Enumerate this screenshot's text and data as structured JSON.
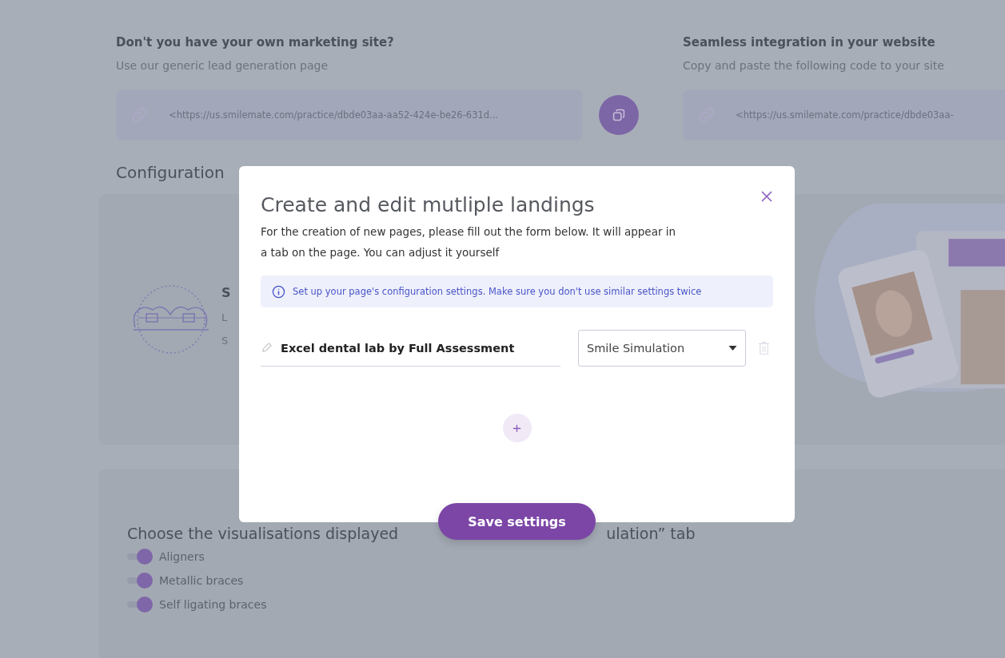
{
  "integration": [
    {
      "title": "Don't you have your own marketing site?",
      "subtitle": "Use our generic lead generation page",
      "link": "<https://us.smilemate.com/practice/dbde03aa-aa52-424e-be26-631d...",
      "copy_button": true
    },
    {
      "title": "Seamless integration in your website",
      "subtitle": "Copy and paste the following code to your site",
      "link": "<https://us.smilemate.com/practice/dbde03aa-",
      "copy_button": false
    }
  ],
  "configuration": {
    "title": "Configuration",
    "card_title": "S",
    "card_lines": [
      "L",
      "S"
    ],
    "illustration": {
      "kind": "picture"
    }
  },
  "visualisations": {
    "title_parts": [
      "Choose the visualisations displayed",
      "ulation” tab"
    ],
    "toggles": [
      {
        "label": "Aligners",
        "on": true
      },
      {
        "label": "Metallic braces",
        "on": true
      },
      {
        "label": "Self ligating braces",
        "on": true
      }
    ]
  },
  "modal": {
    "title": "Create and edit mutliple landings",
    "description": "For the creation of new pages, please fill out the form below. It will appear in a tab on the page. You can adjust it yourself",
    "info": "Set up your page's configuration settings. Make sure you don't use similar settings twice",
    "landings": [
      {
        "name": "Excel dental lab by Full Assessment",
        "type": "Smile Simulation"
      }
    ],
    "save_button": "Save settings"
  }
}
